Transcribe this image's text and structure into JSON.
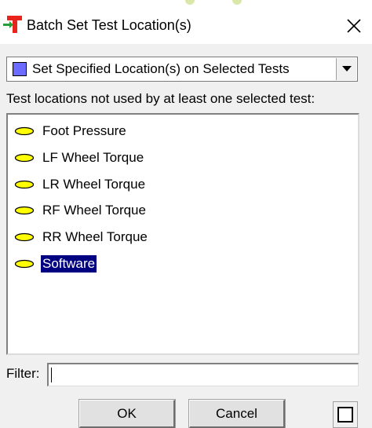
{
  "window": {
    "title": "Batch Set Test Location(s)"
  },
  "mode_select": {
    "selected": "Set Specified Location(s) on Selected Tests",
    "swatch_color": "#6b6bff"
  },
  "list": {
    "caption": "Test locations not used by at least one selected test:",
    "items": [
      {
        "label": "Foot Pressure",
        "selected": false
      },
      {
        "label": "LF Wheel Torque",
        "selected": false
      },
      {
        "label": "LR Wheel Torque",
        "selected": false
      },
      {
        "label": "RF Wheel Torque",
        "selected": false
      },
      {
        "label": "RR Wheel Torque",
        "selected": false
      },
      {
        "label": "Software",
        "selected": true
      }
    ],
    "icon": "yellow-ellipse-icon",
    "icon_color": "#ffff00",
    "selection_color": "#000080"
  },
  "filter": {
    "label": "Filter:",
    "value": ""
  },
  "buttons": {
    "ok": "OK",
    "cancel": "Cancel"
  }
}
